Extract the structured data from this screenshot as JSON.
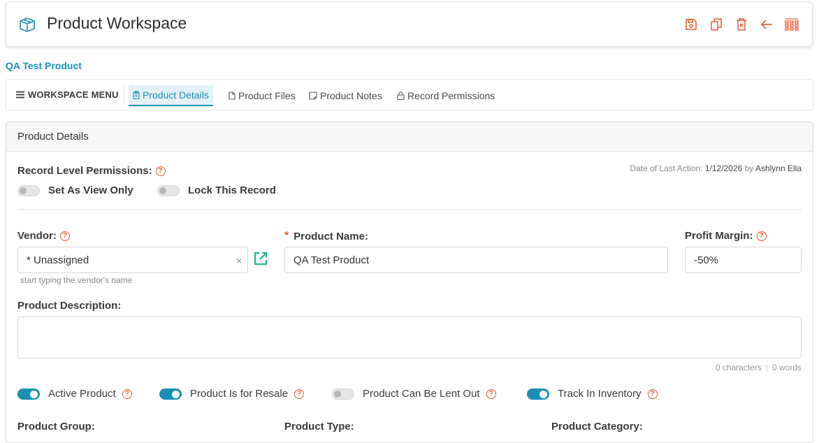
{
  "header": {
    "title": "Product Workspace",
    "icons": [
      "box-icon",
      "save-icon",
      "copy-icon",
      "delete-icon",
      "back-arrow-icon",
      "grid-menu-icon"
    ]
  },
  "breadcrumb": "QA Test Product",
  "workspace": {
    "menu_label": "WORKSPACE MENU",
    "tabs": [
      {
        "label": "Product Details",
        "active": true
      },
      {
        "label": "Product Files"
      },
      {
        "label": "Product Notes"
      },
      {
        "label": "Record Permissions"
      }
    ]
  },
  "panel": {
    "title": "Product Details",
    "permissions_label": "Record Level Permissions:",
    "view_only_label": "Set As View Only",
    "lock_label": "Lock This Record",
    "meta": {
      "prefix": "Date of Last Action:",
      "date": "1/12/2026",
      "by": "by",
      "user": "Ashlynn Ella"
    },
    "vendor": {
      "label": "Vendor:",
      "value": "* Unassigned",
      "hint": "start typing the vendor's name"
    },
    "product_name": {
      "label": "Product Name:",
      "value": "QA Test Product"
    },
    "profit_margin": {
      "label": "Profit Margin:",
      "value": "-50%"
    },
    "description": {
      "label": "Product Description:",
      "value": "",
      "chars": "0 characters",
      "words": "0 words"
    },
    "toggles": [
      {
        "label": "Active Product",
        "on": true
      },
      {
        "label": "Product Is for Resale",
        "on": true
      },
      {
        "label": "Product Can Be Lent Out",
        "on": false
      },
      {
        "label": "Track In Inventory",
        "on": true
      }
    ],
    "group_label": "Product Group:",
    "type_label": "Product Type:",
    "category_label": "Product Category:"
  },
  "colors": {
    "accent": "#1a8fb5",
    "action": "#e55a2b",
    "link_icon": "#1fb58a"
  }
}
